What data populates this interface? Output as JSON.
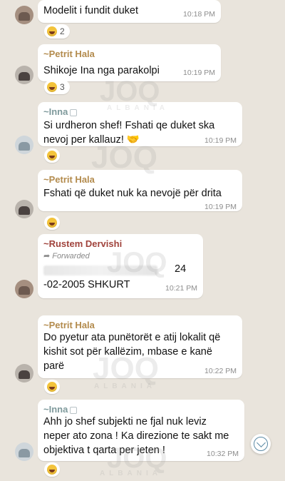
{
  "messages": [
    {
      "sender": "",
      "text_lines": [
        "Modelit i fundit duket"
      ],
      "time": "10:18 PM",
      "reaction_count": "2"
    },
    {
      "sender": "~Petrit Hala",
      "text_lines": [
        "Shikoje Ina nga parakolpi"
      ],
      "time": "10:19 PM",
      "reaction_count": "3"
    },
    {
      "sender": "~Inna",
      "text_lines": [
        "Si urdheron shef! Fshati qe duket ska",
        "nevoj per kallauz! 🤝"
      ],
      "time": "10:19 PM",
      "reaction_count": ""
    },
    {
      "sender": "~Petrit Hala",
      "text_lines": [
        "Fshati që duket nuk ka nevojë për drita"
      ],
      "time": "10:19 PM",
      "reaction_count": ""
    },
    {
      "sender": "~Rustem Dervishi",
      "forwarded_label": "Forwarded",
      "text_lines": [
        "24",
        "-02-2005 SHKURT"
      ],
      "time": "10:21 PM",
      "reaction_count": ""
    },
    {
      "sender": "~Petrit Hala",
      "text_lines": [
        "Do pyetur ata punëtorët e atij lokalit që",
        "kishit sot për kallëzim, mbase e kanë",
        "parë"
      ],
      "time": "10:22 PM",
      "reaction_count": ""
    },
    {
      "sender": "~Inna",
      "text_lines": [
        "Ahh jo shef subjekti ne fjal nuk leviz",
        "neper ato zona ! Ka direzione te sakt me",
        "objektiva  t qarta per jeten !"
      ],
      "time": "10:32 PM",
      "reaction_count": ""
    }
  ],
  "icons": {
    "reaction": "laughing-emoji-icon",
    "scroll": "scroll-down-icon",
    "forward": "forward-arrow-icon"
  },
  "colors": {
    "chat_bg": "#e9e4dc",
    "bubble_bg": "#ffffff",
    "petrit": "#b38b4d",
    "inna": "#7f9a9c",
    "rustem": "#a0433c"
  },
  "watermark": {
    "logo": "JOQ",
    "subtitle": "ALBANIA"
  }
}
